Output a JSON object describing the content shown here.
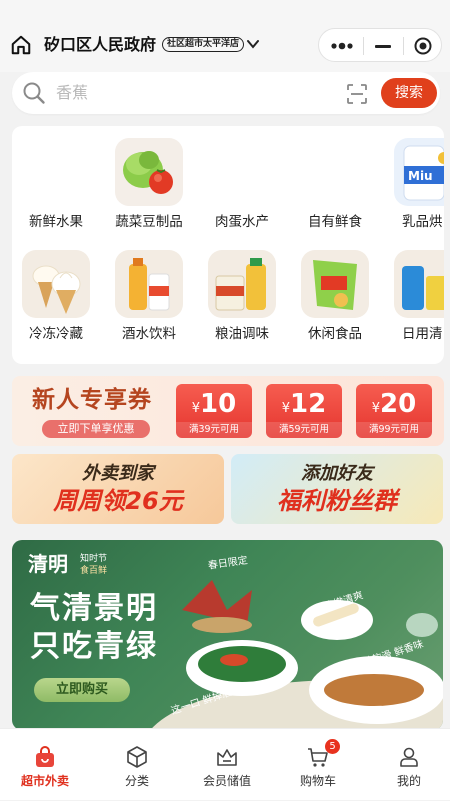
{
  "header": {
    "location": "矽口区人民政府",
    "store_badge": "社区超市太平洋店"
  },
  "search": {
    "placeholder": "香蕉",
    "button": "搜索"
  },
  "categories": [
    {
      "label": "新鲜水果"
    },
    {
      "label": "蔬菜豆制品"
    },
    {
      "label": "肉蛋水产"
    },
    {
      "label": "自有鲜食"
    },
    {
      "label": "乳品烘"
    },
    {
      "label": "冷冻冷藏"
    },
    {
      "label": "酒水饮料"
    },
    {
      "label": "粮油调味"
    },
    {
      "label": "休闲食品"
    },
    {
      "label": "日用清"
    }
  ],
  "coupon_strip": {
    "title": "新人专享券",
    "subtitle": "立即下单享优惠",
    "coupons": [
      {
        "currency": "¥",
        "amount": "10",
        "condition": "满39元可用"
      },
      {
        "currency": "¥",
        "amount": "12",
        "condition": "满59元可用"
      },
      {
        "currency": "¥",
        "amount": "20",
        "condition": "满99元可用"
      }
    ]
  },
  "promos": [
    {
      "line1": "外卖到家",
      "line2": "周周领26元"
    },
    {
      "line1": "添加好友",
      "line2": "福利粉丝群"
    }
  ],
  "banner": {
    "brand": "清明",
    "tag1": "知时节",
    "tag2": "食百鲜",
    "headline1": "气清景明",
    "headline2": "只吃青绿",
    "cta": "立即购买",
    "labels": [
      "春日限定",
      "脆嫩清爽",
      "细嫩软滑 鲜香味",
      "这一口 鲜掉眉毛"
    ]
  },
  "tabbar": [
    {
      "label": "超市外卖",
      "icon": "shopping-bag-icon",
      "active": true
    },
    {
      "label": "分类",
      "icon": "cube-icon"
    },
    {
      "label": "会员储值",
      "icon": "crown-icon"
    },
    {
      "label": "购物车",
      "icon": "cart-icon",
      "badge": "5"
    },
    {
      "label": "我的",
      "icon": "user-icon"
    }
  ],
  "colors": {
    "accent": "#e0401c",
    "active_tab": "#e0301e",
    "coupon_red": "#f04a3e",
    "banner_green": "#3f8556"
  }
}
